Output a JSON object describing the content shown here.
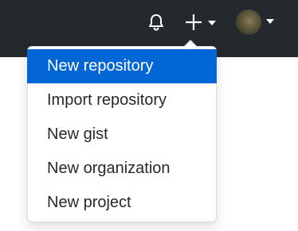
{
  "header": {
    "background": "#24292e",
    "icons": {
      "notifications": "bell-icon",
      "create": "plus-icon",
      "avatar": "avatar"
    }
  },
  "create_menu": {
    "accent": "#0366d6",
    "items": [
      {
        "label": "New repository",
        "selected": true
      },
      {
        "label": "Import repository",
        "selected": false
      },
      {
        "label": "New gist",
        "selected": false
      },
      {
        "label": "New organization",
        "selected": false
      },
      {
        "label": "New project",
        "selected": false
      }
    ]
  }
}
